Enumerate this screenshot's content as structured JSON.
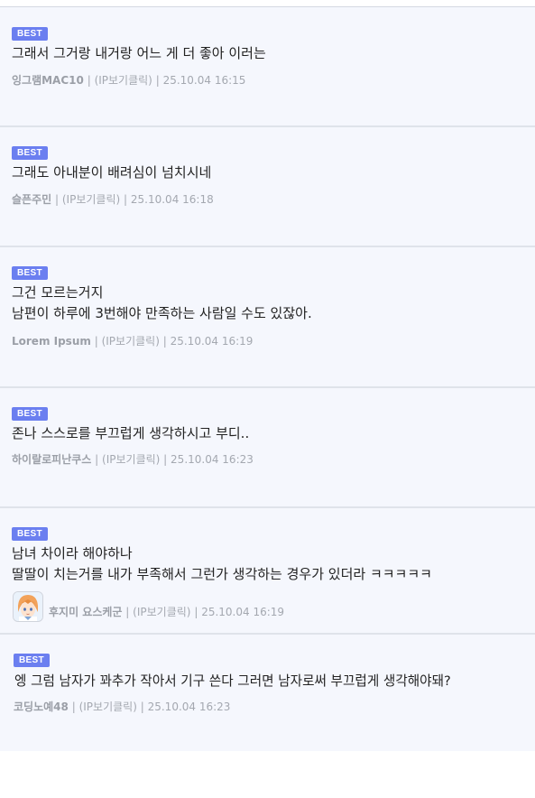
{
  "comments": [
    {
      "badge": "BEST",
      "lines": [
        "그래서 그거랑 내거랑 어느 게 더 좋아 이러는"
      ],
      "nickname": "잉그램MAC10",
      "ip": "(IP보기클릭)",
      "date": "25.10.04 16:15"
    },
    {
      "badge": "BEST",
      "lines": [
        "그래도 아내분이 배려심이 넘치시네"
      ],
      "nickname": "슬픈주민",
      "ip": "(IP보기클릭)",
      "date": "25.10.04 16:18"
    },
    {
      "badge": "BEST",
      "lines": [
        "그건 모르는거지",
        "남편이 하루에 3번해야 만족하는 사람일 수도 있잖아."
      ],
      "nickname": "Lorem Ipsum",
      "ip": "(IP보기클릭)",
      "date": "25.10.04 16:19"
    },
    {
      "badge": "BEST",
      "lines": [
        "존나 스스로를 부끄럽게 생각하시고 부디.."
      ],
      "nickname": "하이랄로피난쿠스",
      "ip": "(IP보기클릭)",
      "date": "25.10.04 16:23"
    },
    {
      "badge": "BEST",
      "lines": [
        "남녀 차이라 해야하나",
        "딸딸이 치는거를 내가 부족해서 그런가 생각하는 경우가 있더라 ㅋㅋㅋㅋㅋ"
      ],
      "nickname": "후지미 요스케군",
      "ip": "(IP보기클릭)",
      "date": "25.10.04 16:19",
      "avatar_icon": "anime-avatar-icon"
    },
    {
      "badge": "BEST",
      "lines": [
        "엥 그럼 남자가 꽈추가 작아서 기구 쓴다 그러면 남자로써 부끄럽게 생각해야돼?"
      ],
      "nickname": "코딩노예48",
      "ip": "(IP보기클릭)",
      "date": "25.10.04 16:23"
    }
  ],
  "separator": "|",
  "colors": {
    "badge": "#6b7ff0",
    "background": "#f5f7fd",
    "text": "#222222",
    "meta": "#a4a8b0"
  }
}
